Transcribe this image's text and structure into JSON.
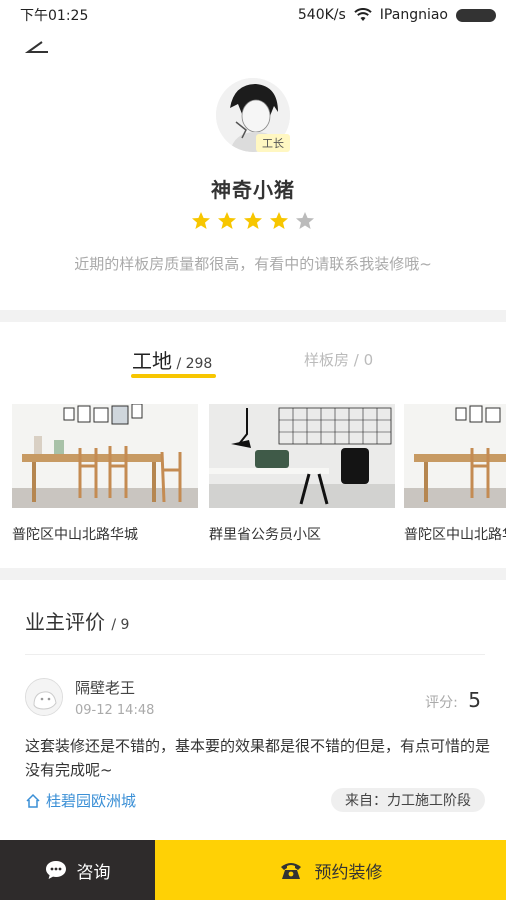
{
  "status_bar": {
    "time": "下午01:25",
    "speed": "540K/s",
    "carrier": "IPangniao"
  },
  "profile": {
    "badge": "工长",
    "name": "神奇小猪",
    "rating": 4,
    "rating_max": 5,
    "bio": "近期的样板房质量都很高，有看中的请联系我装修哦~"
  },
  "tabs": [
    {
      "title": "工地",
      "count": "/ 298"
    },
    {
      "title": "样板房",
      "count": "/ 0"
    }
  ],
  "sites": [
    {
      "label": "普陀区中山北路华城"
    },
    {
      "label": "群里省公务员小区"
    },
    {
      "label": "普陀区中山北路华城"
    }
  ],
  "reviews": {
    "title": "业主评价",
    "count": "/ 9",
    "items": [
      {
        "name": "隔壁老王",
        "time": "09-12 14:48",
        "score_label": "评分:",
        "score": "5",
        "text": "这套装修还是不错的，基本要的效果都是很不错的但是，有点可惜的是没有完成呢~",
        "community": "桂碧园欧洲城",
        "source": "来自：力工施工阶段"
      }
    ]
  },
  "bottom": {
    "consult": "咨询",
    "book": "预约装修"
  },
  "colors": {
    "accent": "#ffd105",
    "star_on": "#f7c600",
    "star_off": "#bbbbbb",
    "link": "#3a8fd6",
    "dark_button": "#2e2b2b"
  }
}
